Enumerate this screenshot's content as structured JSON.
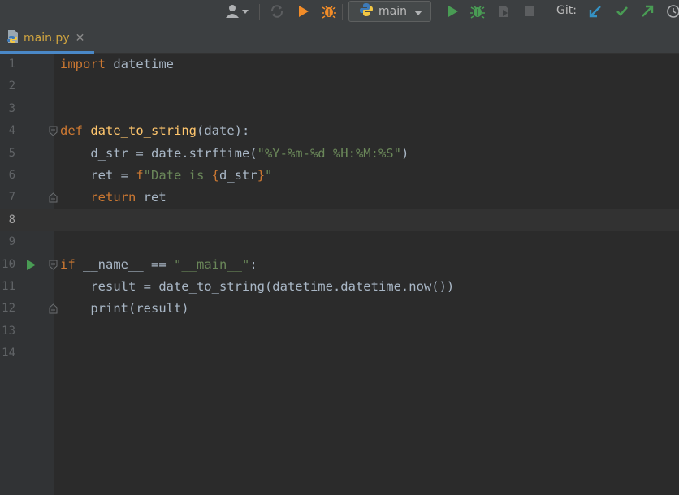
{
  "toolbar": {
    "config_name": "main",
    "git_label": "Git:",
    "icons": [
      "user-icon",
      "sync-icon",
      "run-icon",
      "debug-icon",
      "python-icon",
      "run-icon",
      "debug-icon",
      "coverage-icon",
      "stop-icon",
      "git-update-icon",
      "git-commit-icon",
      "git-push-icon",
      "history-icon"
    ]
  },
  "tab": {
    "label": "main.py",
    "close": "✕"
  },
  "colors": {
    "background": "#2b2b2b",
    "keyword": "#cc7832",
    "function": "#ffc66d",
    "string": "#6a8759",
    "text": "#a9b7c6",
    "line_number": "#606366",
    "run_green": "#499c54"
  },
  "editor": {
    "current_line": 8,
    "line_numbers": [
      "1",
      "2",
      "3",
      "4",
      "5",
      "6",
      "7",
      "8",
      "9",
      "10",
      "11",
      "12",
      "13",
      "14"
    ],
    "lines": [
      [
        {
          "k": "kw",
          "t": "import"
        },
        {
          "k": "txt",
          "t": " datetime"
        }
      ],
      [],
      [],
      [
        {
          "k": "kw",
          "t": "def"
        },
        {
          "k": "txt",
          "t": " "
        },
        {
          "k": "fn",
          "t": "date_to_string"
        },
        {
          "k": "txt",
          "t": "(date):"
        }
      ],
      [
        {
          "k": "txt",
          "t": "    d_str = date.strftime("
        },
        {
          "k": "str",
          "t": "\"%Y-%m-%d %H:%M:%S\""
        },
        {
          "k": "txt",
          "t": ")"
        }
      ],
      [
        {
          "k": "txt",
          "t": "    ret = "
        },
        {
          "k": "kw",
          "t": "f"
        },
        {
          "k": "str",
          "t": "\"Date is "
        },
        {
          "k": "kw",
          "t": "{"
        },
        {
          "k": "txt",
          "t": "d_str"
        },
        {
          "k": "kw",
          "t": "}"
        },
        {
          "k": "str",
          "t": "\""
        }
      ],
      [
        {
          "k": "txt",
          "t": "    "
        },
        {
          "k": "kw",
          "t": "return"
        },
        {
          "k": "txt",
          "t": " ret"
        }
      ],
      [],
      [],
      [
        {
          "k": "kw",
          "t": "if"
        },
        {
          "k": "txt",
          "t": " __name__ == "
        },
        {
          "k": "str",
          "t": "\"__main__\""
        },
        {
          "k": "txt",
          "t": ":"
        }
      ],
      [
        {
          "k": "txt",
          "t": "    result = date_to_string(datetime.datetime.now())"
        }
      ],
      [
        {
          "k": "txt",
          "t": "    print(result)"
        }
      ],
      [],
      []
    ]
  }
}
